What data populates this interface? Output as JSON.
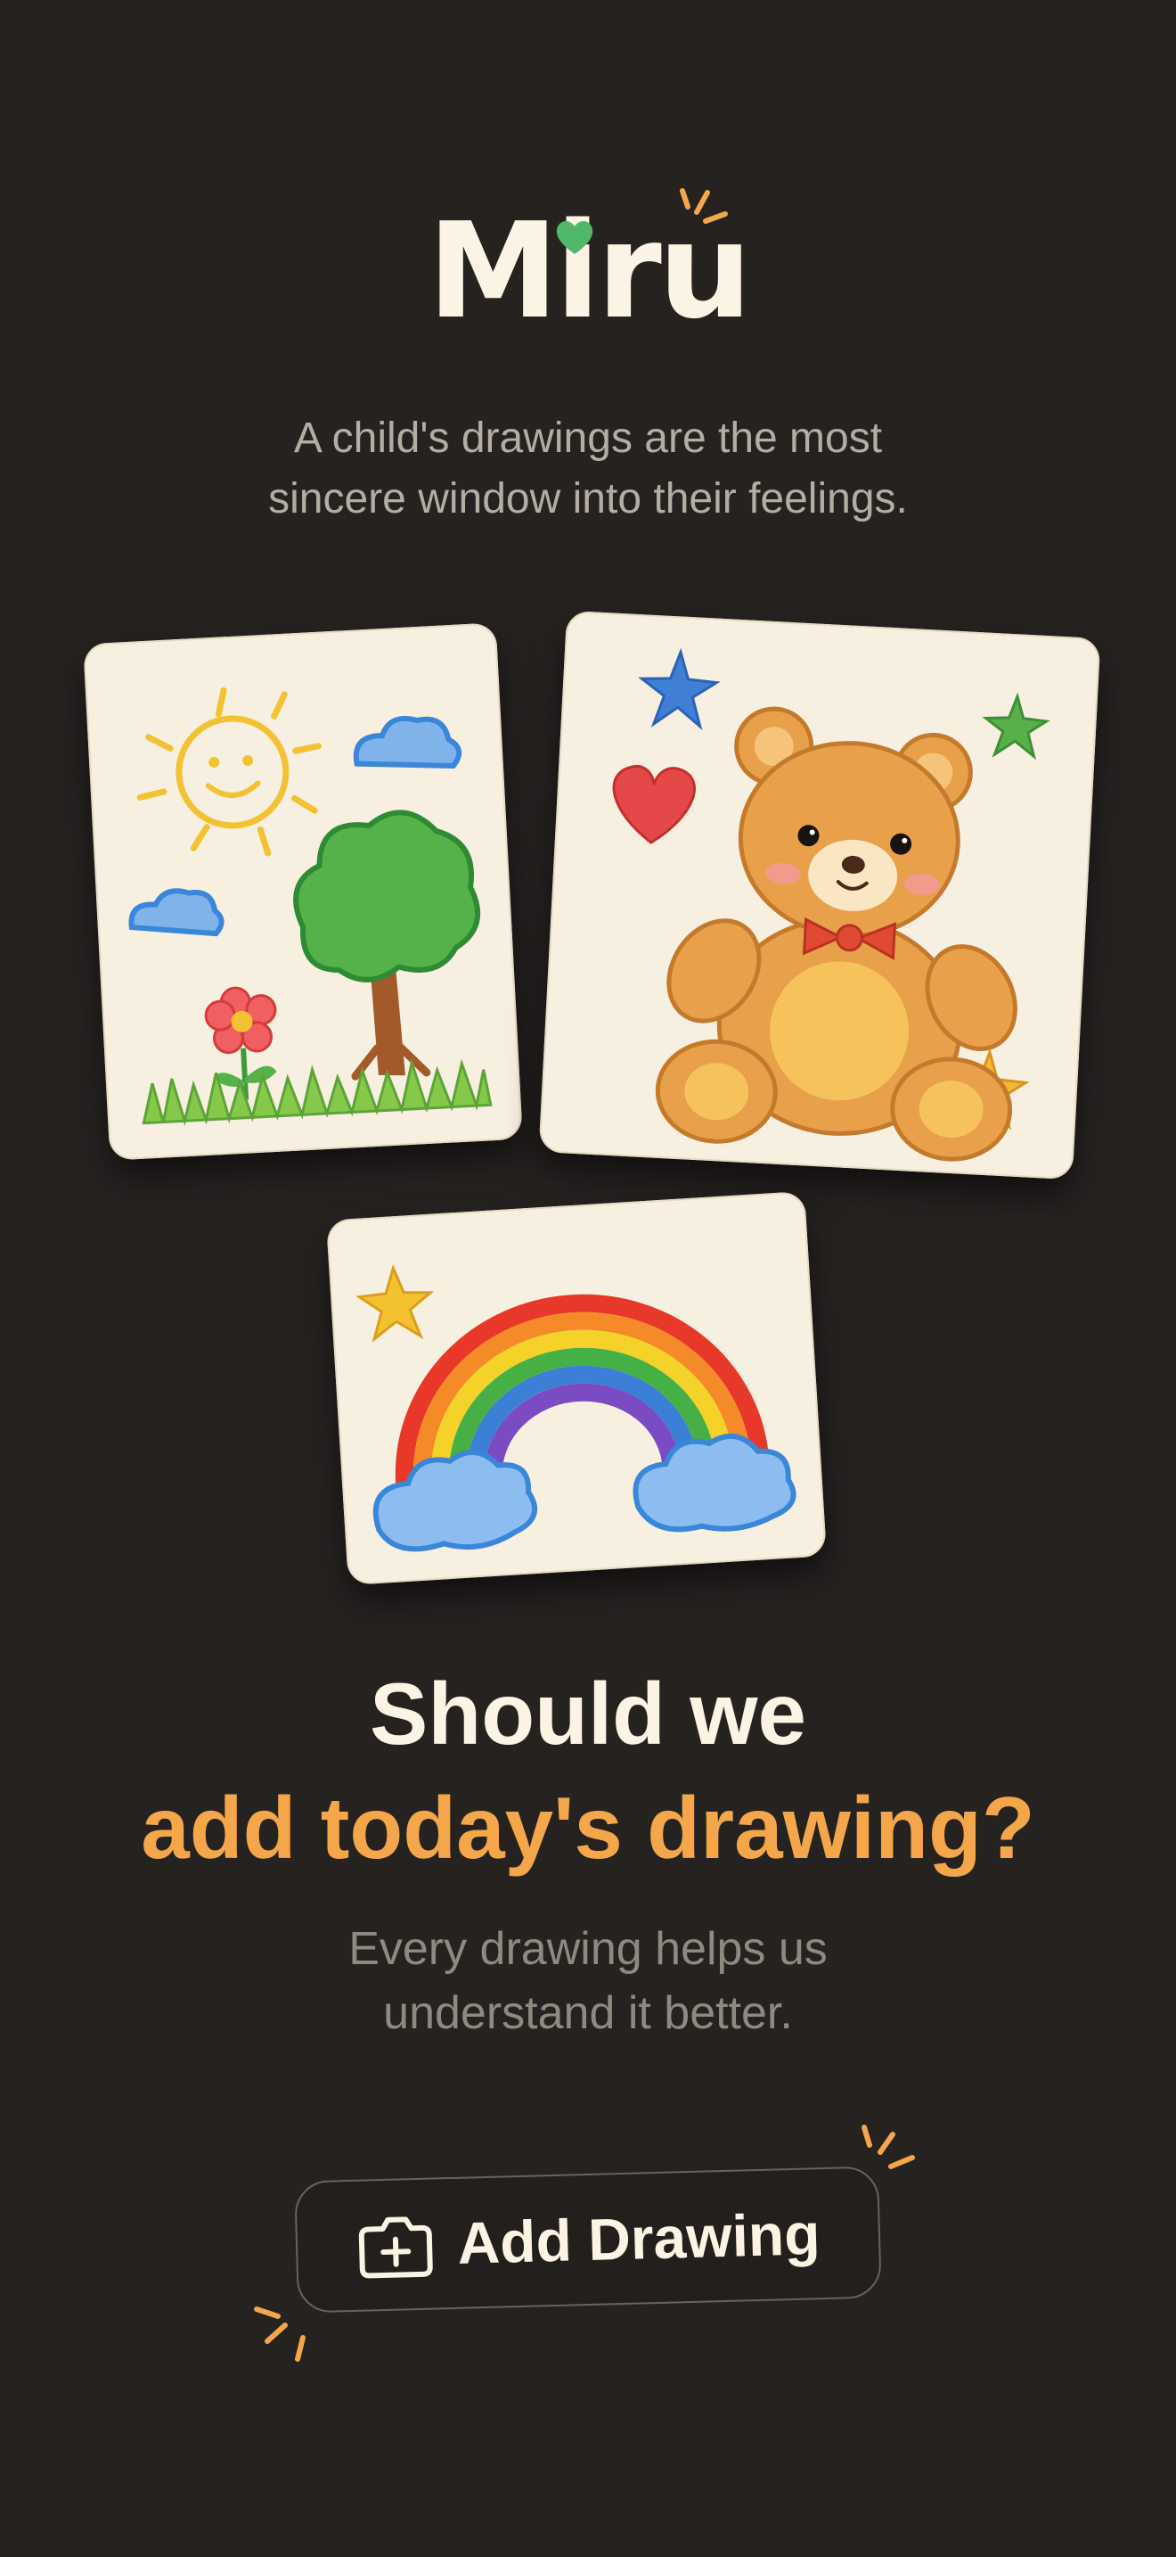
{
  "app": {
    "logo": "Miru"
  },
  "intro": {
    "tagline_line1": "A child's drawings are the most",
    "tagline_line2": "sincere window into their feelings."
  },
  "gallery": [
    {
      "subject": "sun, tree, flower and grass"
    },
    {
      "subject": "teddy bear with stars and heart"
    },
    {
      "subject": "rainbow with clouds"
    }
  ],
  "prompt": {
    "headline_line1": "Should we",
    "headline_line2": "add today's drawing?",
    "sub_line1": "Every drawing helps us",
    "sub_line2": "understand it better."
  },
  "cta": {
    "label": "Add Drawing",
    "icon": "add-photo-icon"
  },
  "colors": {
    "background": "#262220",
    "accent": "#f4a64a",
    "heart": "#4fb86a",
    "text_light": "#fbf3e3",
    "text_muted": "#8f8980"
  }
}
